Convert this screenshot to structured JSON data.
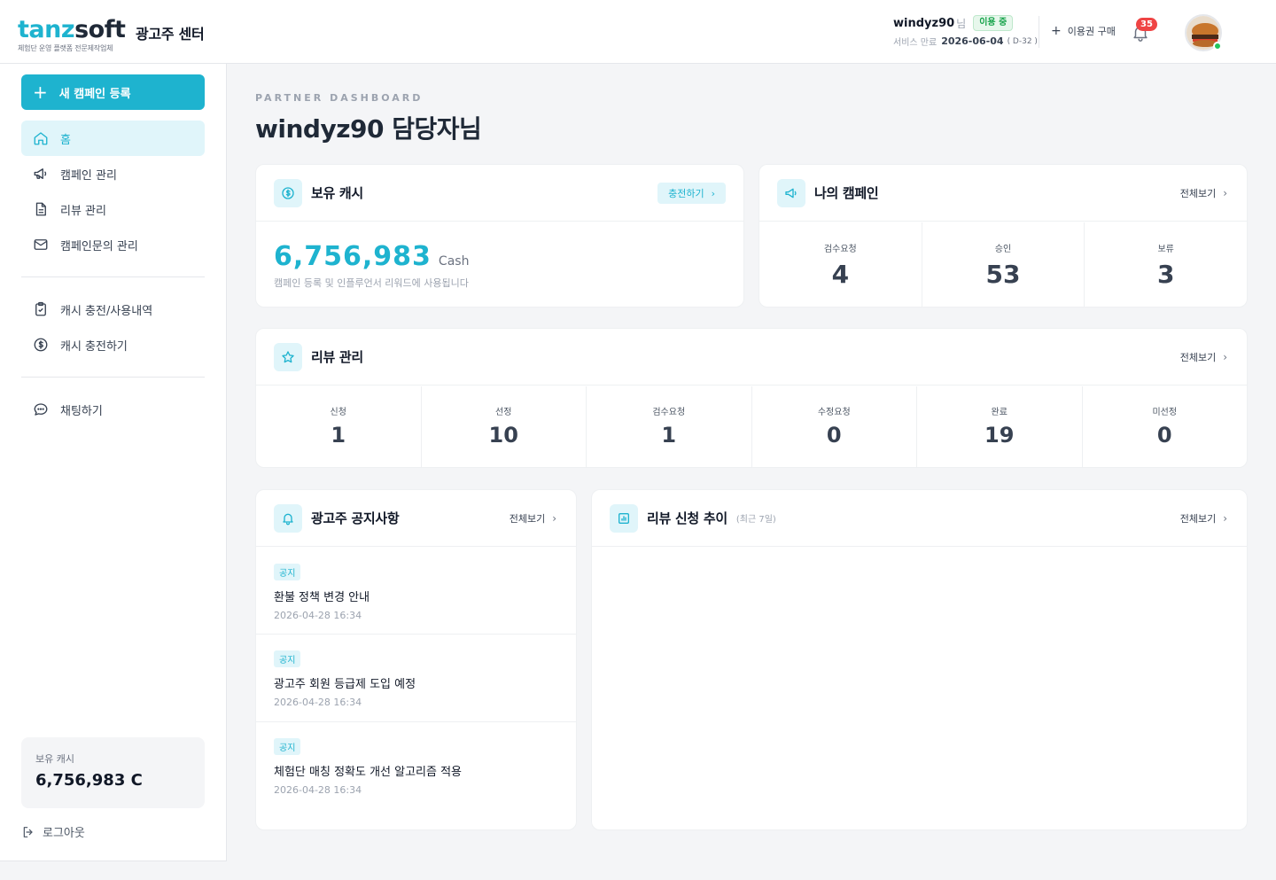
{
  "header": {
    "logo_part1": "tanz",
    "logo_part2": "soft",
    "logo_tagline": "체험단 운영 플랫폼 전문제작업체",
    "center_title": "광고주 센터",
    "user_name": "windyz90",
    "user_suffix": "님",
    "status_badge": "이용 중",
    "expire_label": "서비스 만료",
    "expire_date": "2026-06-04",
    "expire_dday": "( D-32 )",
    "buy_label": "이용권 구매",
    "notification_count": "35"
  },
  "sidebar": {
    "new_campaign": "새 캠페인 등록",
    "items": [
      {
        "label": "홈",
        "icon": "home-icon"
      },
      {
        "label": "캠페인 관리",
        "icon": "megaphone-icon"
      },
      {
        "label": "리뷰 관리",
        "icon": "document-icon"
      },
      {
        "label": "캠페인문의 관리",
        "icon": "mail-icon"
      },
      {
        "label": "캐시 충전/사용내역",
        "icon": "clipboard-check-icon"
      },
      {
        "label": "캐시 충전하기",
        "icon": "dollar-icon"
      },
      {
        "label": "채팅하기",
        "icon": "chat-icon"
      }
    ],
    "cash_label": "보유 캐시",
    "cash_value": "6,756,983 C",
    "logout": "로그아웃"
  },
  "page": {
    "eyebrow": "PARTNER DASHBOARD",
    "title": "windyz90 담당자님"
  },
  "cash_card": {
    "title": "보유 캐시",
    "charge_button": "충전하기",
    "value": "6,756,983",
    "unit": "Cash",
    "description": "캠페인 등록 및 인플루언서 리워드에 사용됩니다"
  },
  "campaign_card": {
    "title": "나의 캠페인",
    "view_all": "전체보기",
    "stats": [
      {
        "label": "검수요청",
        "value": "4"
      },
      {
        "label": "승인",
        "value": "53"
      },
      {
        "label": "보류",
        "value": "3"
      }
    ]
  },
  "review_card": {
    "title": "리뷰 관리",
    "view_all": "전체보기",
    "stats": [
      {
        "label": "신청",
        "value": "1"
      },
      {
        "label": "선정",
        "value": "10"
      },
      {
        "label": "검수요청",
        "value": "1"
      },
      {
        "label": "수정요청",
        "value": "0"
      },
      {
        "label": "완료",
        "value": "19"
      },
      {
        "label": "미선정",
        "value": "0"
      }
    ]
  },
  "notice_card": {
    "title": "광고주 공지사항",
    "view_all": "전체보기",
    "items": [
      {
        "tag": "공지",
        "title": "환불 정책 변경 안내",
        "date": "2026-04-28 16:34"
      },
      {
        "tag": "공지",
        "title": "광고주 회원 등급제 도입 예정",
        "date": "2026-04-28 16:34"
      },
      {
        "tag": "공지",
        "title": "체험단 매칭 정확도 개선 알고리즘 적용",
        "date": "2026-04-28 16:34"
      }
    ]
  },
  "trend_card": {
    "title": "리뷰 신청 추이",
    "subtitle": "(최근 7일)",
    "view_all": "전체보기"
  },
  "colors": {
    "accent": "#1eb3cf",
    "accent_light": "#e0f5fa",
    "status_green": "#16a34a",
    "badge_red": "#ef4444"
  }
}
